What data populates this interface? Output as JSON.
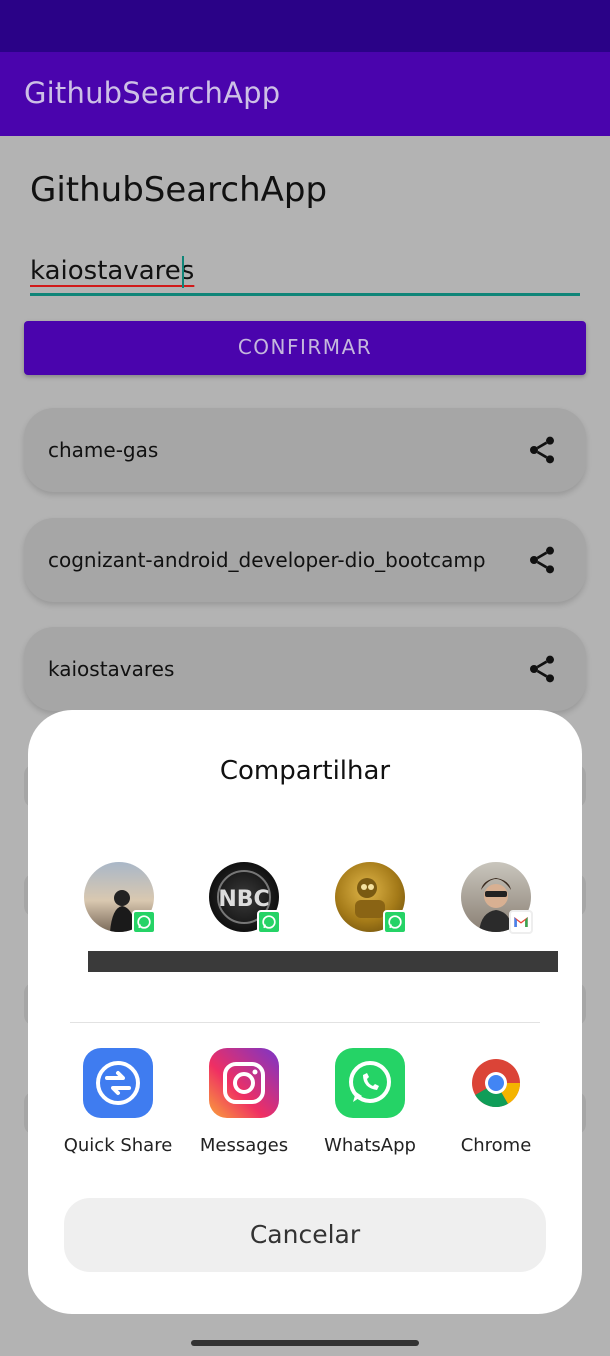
{
  "app_bar": {
    "title": "GithubSearchApp"
  },
  "main": {
    "title": "GithubSearchApp",
    "username_input": "kaiostavares",
    "confirm_label": "CONFIRMAR"
  },
  "repos": [
    {
      "name": "chame-gas"
    },
    {
      "name": "cognizant-android_developer-dio_bootcamp"
    },
    {
      "name": "kaiostavares"
    }
  ],
  "share_sheet": {
    "title": "Compartilhar",
    "contacts": [
      {
        "badge": "whatsapp-icon"
      },
      {
        "badge": "whatsapp-icon"
      },
      {
        "badge": "whatsapp-icon"
      },
      {
        "badge": "gmail-icon"
      }
    ],
    "apps": [
      {
        "label": "Quick Share",
        "icon": "quick-share-icon"
      },
      {
        "label": "Messages",
        "icon": "instagram-icon"
      },
      {
        "label": "WhatsApp",
        "icon": "whatsapp-icon"
      },
      {
        "label": "Chrome",
        "icon": "chrome-icon"
      }
    ],
    "cancel_label": "Cancelar"
  },
  "colors": {
    "primary": "#4a04ad",
    "status_bar": "#2a0287",
    "accent": "#0f8578"
  }
}
